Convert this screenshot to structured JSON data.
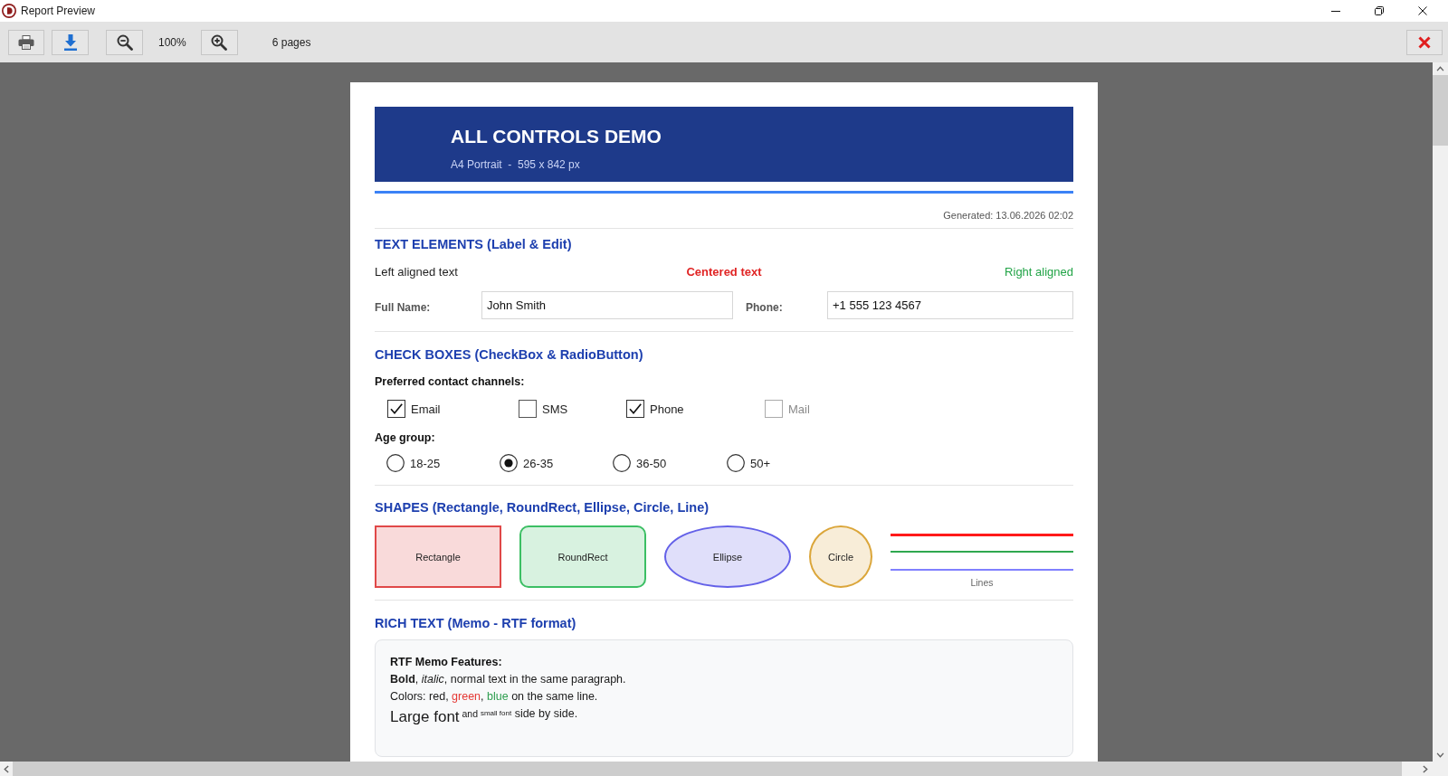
{
  "window": {
    "title": "Report Preview"
  },
  "toolbar": {
    "zoom_level": "100%",
    "page_count": "6 pages"
  },
  "report": {
    "header": {
      "title": "ALL CONTROLS DEMO",
      "subtitle": "A4 Portrait  -  595 x 842 px",
      "generated": "Generated: 13.06.2026 02:02"
    },
    "text_elements": {
      "heading": "TEXT ELEMENTS (Label & Edit)",
      "labels": [
        {
          "kind": "left",
          "text": "Left aligned text",
          "color": "#1f1f1f"
        },
        {
          "kind": "center",
          "text": "Centered text",
          "color": "#e02424"
        },
        {
          "kind": "right",
          "text": "Right aligned",
          "color": "#22a447"
        }
      ],
      "fields": [
        {
          "label": "Full Name:",
          "value": "John Smith"
        },
        {
          "label": "Phone:",
          "value": "+1 555 123 4567"
        }
      ]
    },
    "check_boxes": {
      "heading": "CHECK BOXES (CheckBox & RadioButton)",
      "channels_label": "Preferred contact channels:",
      "channels": [
        {
          "label": "Email",
          "checked": true,
          "disabled": false
        },
        {
          "label": "SMS",
          "checked": false,
          "disabled": false
        },
        {
          "label": "Phone",
          "checked": true,
          "disabled": false
        },
        {
          "label": "Mail",
          "checked": false,
          "disabled": true
        }
      ],
      "age_label": "Age group:",
      "age_groups": [
        {
          "label": "18-25",
          "selected": false
        },
        {
          "label": "26-35",
          "selected": true
        },
        {
          "label": "36-50",
          "selected": false
        },
        {
          "label": "50+",
          "selected": false
        }
      ]
    },
    "shapes": {
      "heading": "SHAPES (Rectangle, RoundRect, Ellipse, Circle, Line)",
      "items": [
        {
          "kind": "rectangle",
          "label": "Rectangle",
          "color": "#e04848"
        },
        {
          "kind": "roundrect",
          "label": "RoundRect",
          "color": "#3cbf64"
        },
        {
          "kind": "ellipse",
          "label": "Ellipse",
          "color": "#6461e8"
        },
        {
          "kind": "circle",
          "label": "Circle",
          "color": "#dba63a"
        },
        {
          "kind": "lines",
          "label": "Lines",
          "lines": [
            {
              "color": "#ff1a1a"
            },
            {
              "color": "#2fa84f"
            },
            {
              "color": "#8080ff"
            }
          ]
        }
      ]
    },
    "rich_text": {
      "heading": "RICH TEXT (Memo - RTF format)",
      "memo": {
        "title": "RTF Memo Features:",
        "lines": [
          {
            "runs": [
              {
                "kind": "plain",
                "text": "**Bold**, *italic*, normal text in the same paragraph."
              }
            ]
          },
          {
            "runs": [
              {
                "kind": "plain",
                "text": "Colors: red, "
              },
              {
                "kind": "plain",
                "text": "green",
                "color": "#e53935"
              },
              {
                "kind": "plain",
                "text": ", "
              },
              {
                "kind": "plain",
                "text": "blue",
                "color": "#2e9e4f"
              },
              {
                "kind": "plain",
                "text": " on the same line."
              }
            ]
          },
          {
            "runs": [
              {
                "kind": "large",
                "text": "Large font"
              },
              {
                "kind": "small",
                "text": " and "
              },
              {
                "kind": "tiny",
                "text": "small font"
              },
              {
                "kind": "plain",
                "text": " side by side."
              }
            ]
          }
        ]
      }
    }
  }
}
